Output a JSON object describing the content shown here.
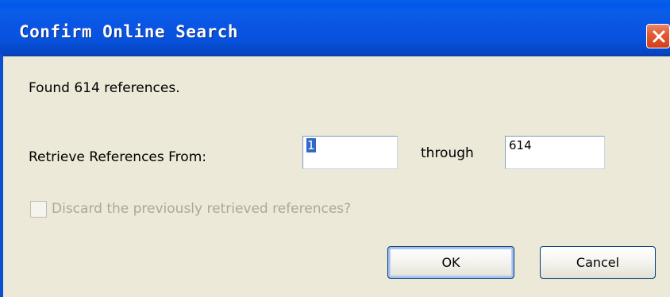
{
  "window": {
    "title": "Confirm Online Search"
  },
  "message": "Found 614 references.",
  "range": {
    "label": "Retrieve References From:",
    "from_value": "1",
    "through_label": "through",
    "to_value": "614"
  },
  "discard": {
    "label": "Discard the previously retrieved references?",
    "checked": false,
    "enabled": false
  },
  "buttons": {
    "ok_label": "OK",
    "cancel_label": "Cancel"
  },
  "icons": {
    "close": "close-icon"
  },
  "colors": {
    "titlebar": "#0058EE",
    "dialog_bg": "#ECE9D8",
    "close_button": "#E25B34",
    "selection": "#316AC5",
    "disabled_text": "#ACA899"
  }
}
